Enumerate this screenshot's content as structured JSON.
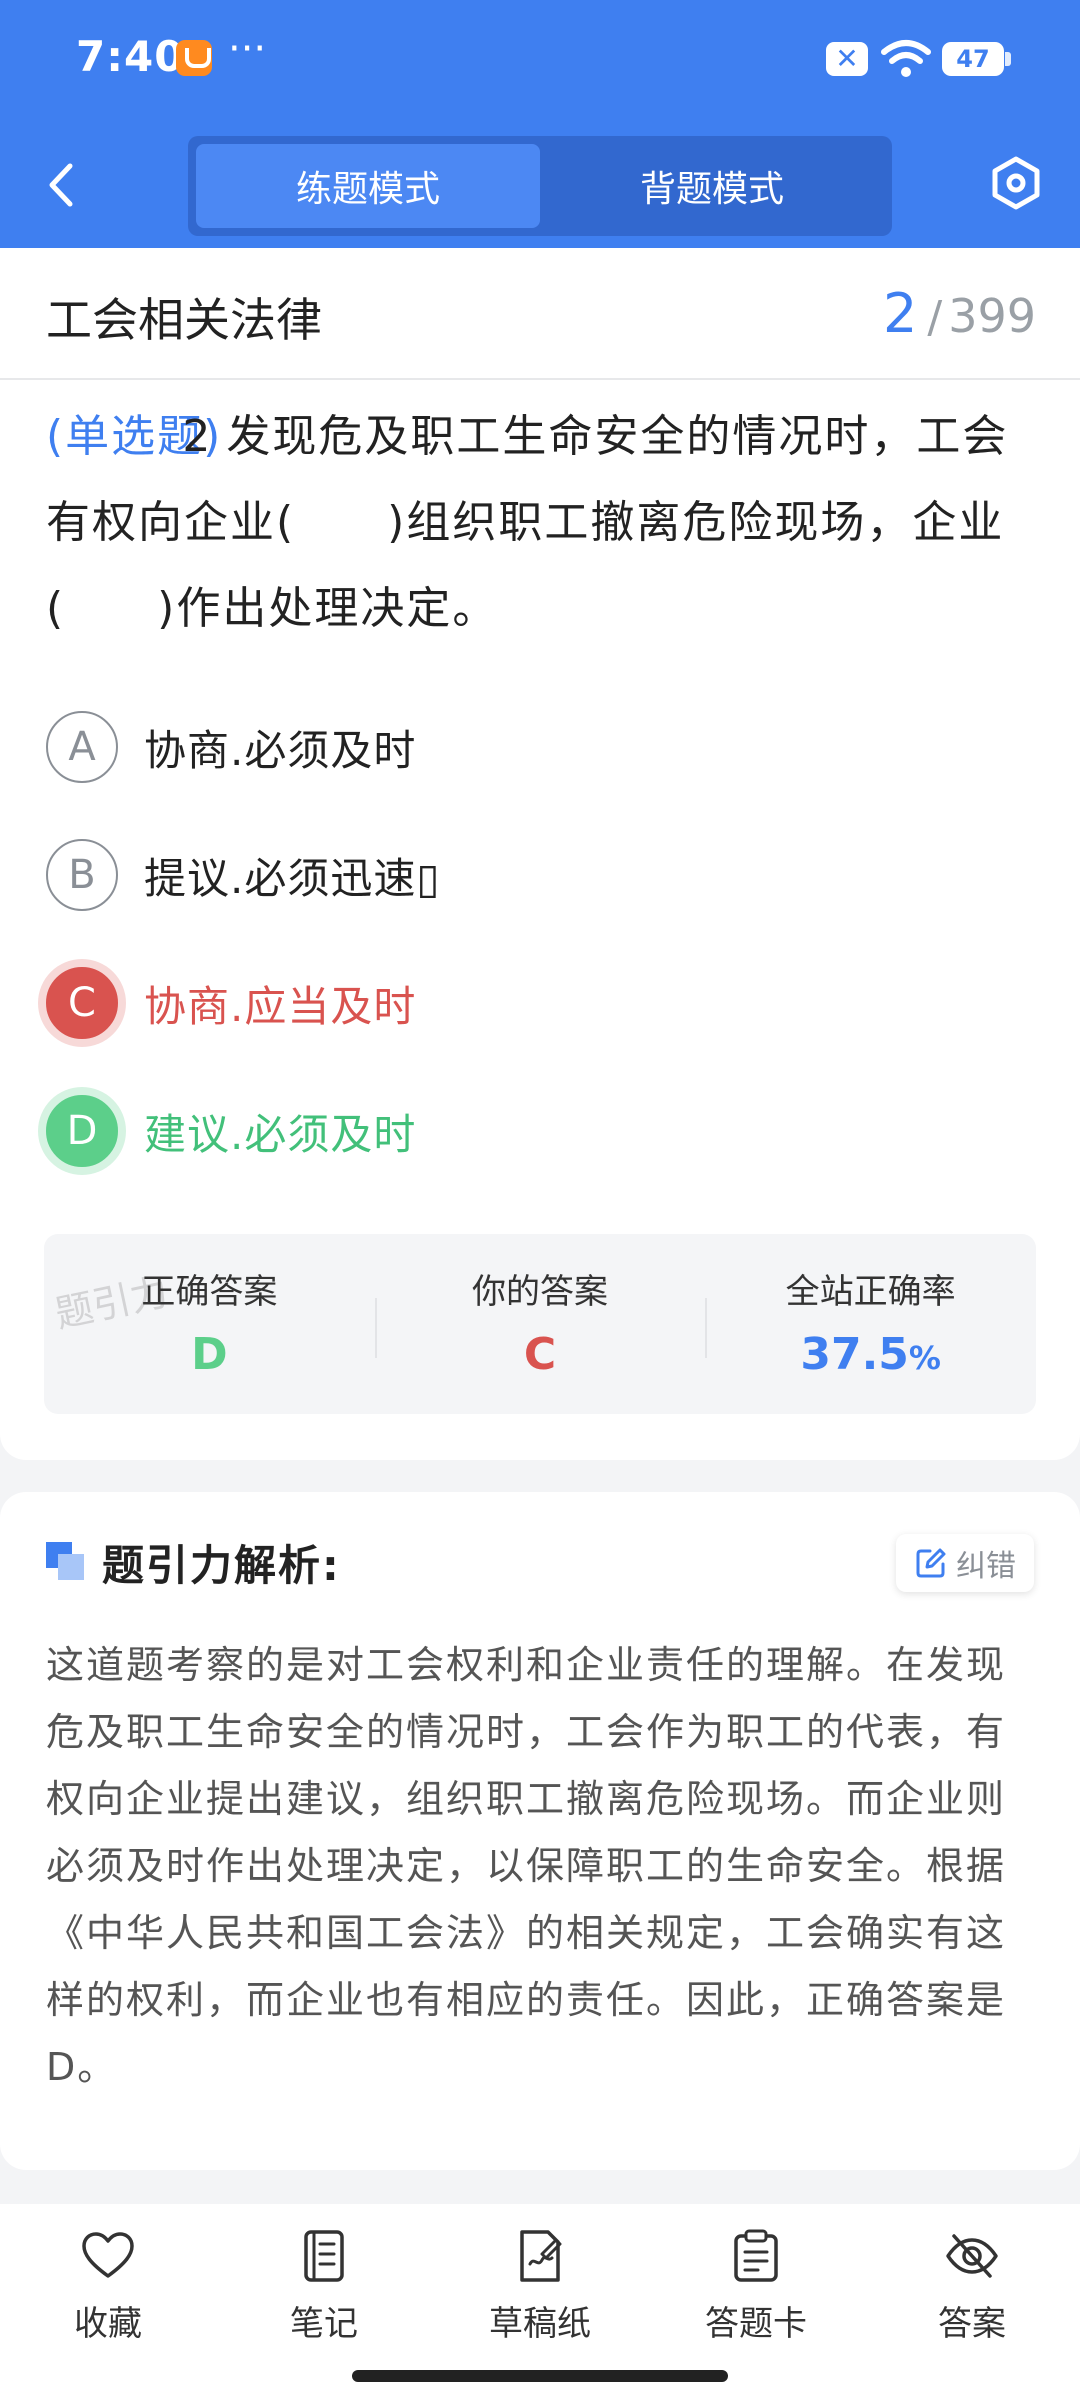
{
  "status_bar": {
    "time": "7:40",
    "dots": "···",
    "notification_icon": "x-icon",
    "battery": "47"
  },
  "header": {
    "tabs": [
      {
        "label": "练题模式",
        "active": true
      },
      {
        "label": "背题模式",
        "active": false
      }
    ],
    "back_icon": "chevron-left-icon",
    "settings_icon": "hexagon-settings-icon",
    "accent": "#3f7ff0"
  },
  "category": {
    "title": "工会相关法律",
    "current": "2",
    "separator": "/",
    "total": "399"
  },
  "question": {
    "type": "(单选题)",
    "number": "2",
    "text": "发现危及职工生命安全的情况时，工会有权向企业(　　)组织职工撤离危险现场，企业(　　)作出处理决定。"
  },
  "options": [
    {
      "letter": "A",
      "text": "协商.必须及时",
      "state": "normal"
    },
    {
      "letter": "B",
      "text": "提议.必须迅速▯",
      "state": "normal"
    },
    {
      "letter": "C",
      "text": "协商.应当及时",
      "state": "wrong"
    },
    {
      "letter": "D",
      "text": "建议.必须及时",
      "state": "correct"
    }
  ],
  "result": {
    "correct_label": "正确答案",
    "correct_value": "D",
    "yours_label": "你的答案",
    "yours_value": "C",
    "rate_label": "全站正确率",
    "rate_value": "37.5",
    "rate_unit": "%",
    "watermark": "题引力"
  },
  "analysis": {
    "title": "题引力解析:",
    "report_label": "纠错",
    "body": "这道题考察的是对工会权利和企业责任的理解。在发现危及职工生命安全的情况时，工会作为职工的代表，有权向企业提出建议，组织职工撤离危险现场。而企业则必须及时作出处理决定，以保障职工的生命安全。根据《中华人民共和国工会法》的相关规定，工会确实有这样的权利，而企业也有相应的责任。因此，正确答案是D。"
  },
  "toolbar": [
    {
      "label": "收藏",
      "icon": "heart-icon"
    },
    {
      "label": "笔记",
      "icon": "notebook-icon"
    },
    {
      "label": "草稿纸",
      "icon": "draft-paper-icon"
    },
    {
      "label": "答题卡",
      "icon": "clipboard-icon"
    },
    {
      "label": "答案",
      "icon": "eye-off-icon"
    }
  ],
  "colors": {
    "primary": "#3f7ff0",
    "wrong": "#d9534f",
    "correct": "#5ccf8a"
  }
}
